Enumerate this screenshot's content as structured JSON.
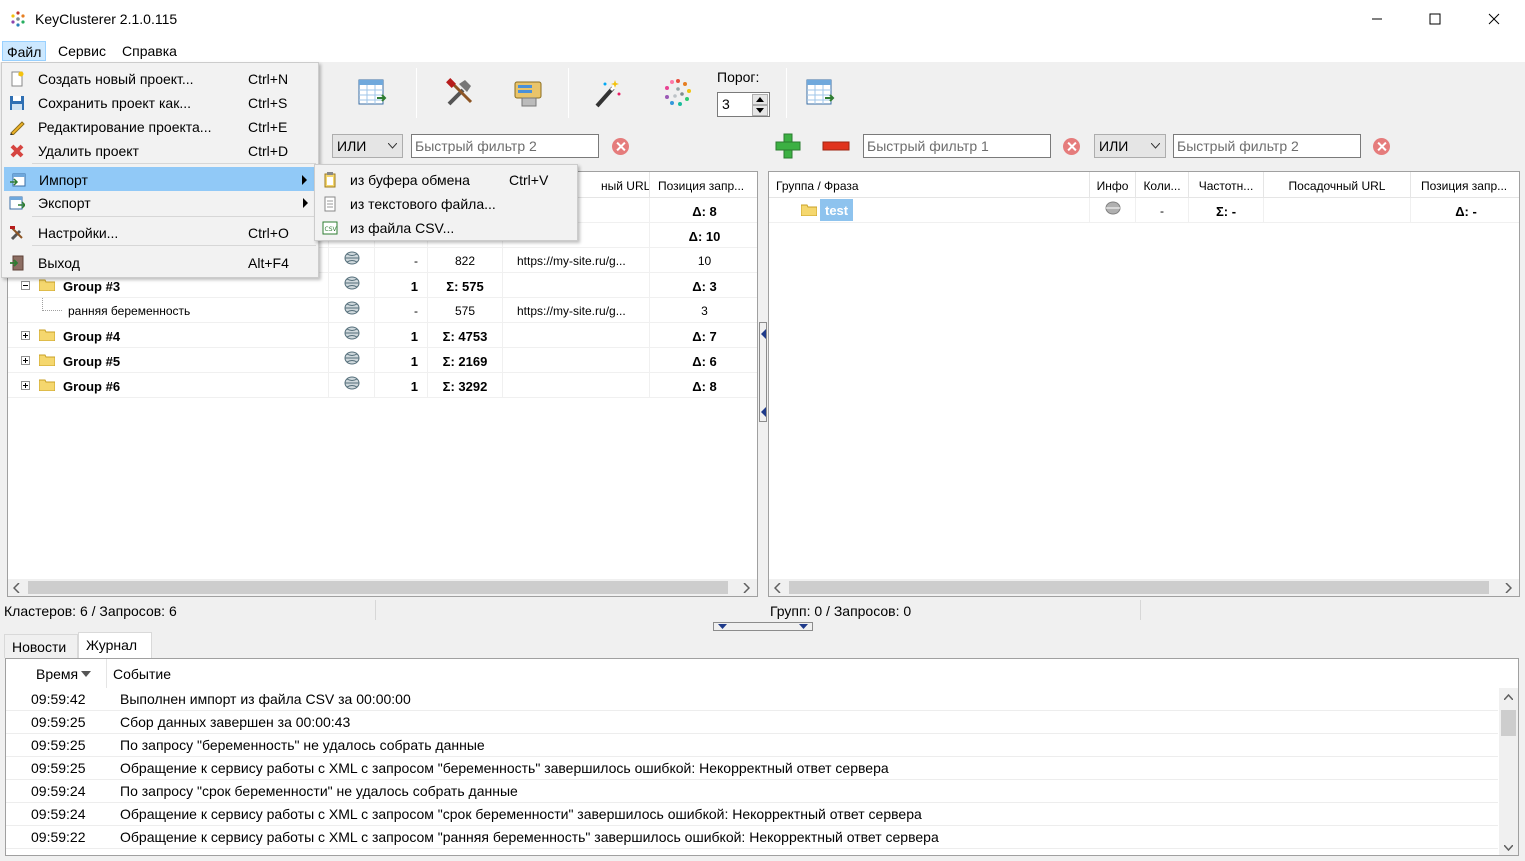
{
  "window": {
    "title": "KeyClusterer 2.1.0.115",
    "icon": "app-logo-icon"
  },
  "menubar": {
    "items": [
      "Файл",
      "Сервис",
      "Справка"
    ]
  },
  "toolbar": {
    "threshold_label": "Порог:",
    "threshold_value": "3"
  },
  "left_filters": {
    "operator": "ИЛИ",
    "filter2_placeholder": "Быстрый фильтр 2"
  },
  "right_filters": {
    "filter1_placeholder": "Быстрый фильтр 1",
    "operator": "ИЛИ",
    "filter2_placeholder": "Быстрый фильтр 2"
  },
  "left_grid": {
    "headers": {
      "url_partial": "ный URL",
      "position": "Позиция запр..."
    },
    "rows": [
      {
        "name": "",
        "count": "",
        "freq": "",
        "url": "",
        "pos": "Δ: 8",
        "bold": true
      },
      {
        "name": "",
        "count": "",
        "freq": "",
        "url": "",
        "pos": "Δ: 10",
        "bold": true
      },
      {
        "name": "",
        "count": "-",
        "freq": "822",
        "url": "https://my-site.ru/g...",
        "pos": "10",
        "bold": false
      },
      {
        "name": "Group #3",
        "count": "1",
        "freq": "Σ: 575",
        "url": "",
        "pos": "Δ: 3",
        "bold": true
      },
      {
        "name": "ранняя беременность",
        "count": "-",
        "freq": "575",
        "url": "https://my-site.ru/g...",
        "pos": "3",
        "bold": false
      },
      {
        "name": "Group #4",
        "count": "1",
        "freq": "Σ: 4753",
        "url": "",
        "pos": "Δ: 7",
        "bold": true
      },
      {
        "name": "Group #5",
        "count": "1",
        "freq": "Σ: 2169",
        "url": "",
        "pos": "Δ: 6",
        "bold": true
      },
      {
        "name": "Group #6",
        "count": "1",
        "freq": "Σ: 3292",
        "url": "",
        "pos": "Δ: 8",
        "bold": true
      }
    ]
  },
  "right_grid": {
    "headers": {
      "group": "Группа / Фраза",
      "info": "Инфо",
      "count": "Коли...",
      "freq": "Частотн...",
      "url": "Посадочный URL",
      "position": "Позиция запр..."
    },
    "rows": [
      {
        "name": "test",
        "count": "-",
        "freq": "Σ: -",
        "pos": "Δ: -"
      }
    ]
  },
  "status": {
    "left": "Кластеров: 6 / Запросов: 6",
    "right": "Групп: 0 / Запросов: 0"
  },
  "bottom_tabs": [
    "Новости",
    "Журнал"
  ],
  "log": {
    "col_time": "Время",
    "col_event": "Событие",
    "rows": [
      {
        "time": "09:59:42",
        "msg": "Выполнен импорт из файла CSV за 00:00:00"
      },
      {
        "time": "09:59:25",
        "msg": "Сбор данных завершен за 00:00:43"
      },
      {
        "time": "09:59:25",
        "msg": "По запросу \"беременность\" не удалось собрать данные"
      },
      {
        "time": "09:59:25",
        "msg": "Обращение к сервису работы с XML с запросом \"беременность\" завершилось ошибкой: Некорректный ответ сервера"
      },
      {
        "time": "09:59:24",
        "msg": "По запросу \"срок беременности\" не удалось собрать данные"
      },
      {
        "time": "09:59:24",
        "msg": "Обращение к сервису работы с XML с запросом \"срок беременности\" завершилось ошибкой: Некорректный ответ сервера"
      },
      {
        "time": "09:59:22",
        "msg": "Обращение к сервису работы с XML с запросом \"ранняя беременность\" завершилось ошибкой: Некорректный ответ сервера"
      }
    ]
  },
  "file_menu": {
    "items": [
      {
        "label": "Создать новый проект...",
        "shortcut": "Ctrl+N",
        "icon": "new-document-icon"
      },
      {
        "label": "Сохранить проект как...",
        "shortcut": "Ctrl+S",
        "icon": "floppy-disk-icon"
      },
      {
        "label": "Редактирование проекта...",
        "shortcut": "Ctrl+E",
        "icon": "pencil-icon"
      },
      {
        "label": "Удалить проект",
        "shortcut": "Ctrl+D",
        "icon": "red-cross-icon"
      },
      {
        "label": "Импорт",
        "shortcut": "",
        "icon": "import-icon"
      },
      {
        "label": "Экспорт",
        "shortcut": "",
        "icon": "export-icon"
      },
      {
        "label": "Настройки...",
        "shortcut": "Ctrl+O",
        "icon": "tools-icon"
      },
      {
        "label": "Выход",
        "shortcut": "Alt+F4",
        "icon": "exit-door-icon"
      }
    ]
  },
  "import_submenu": {
    "items": [
      {
        "label": "из буфера обмена",
        "shortcut": "Ctrl+V",
        "icon": "clipboard-icon"
      },
      {
        "label": "из текстового файла...",
        "shortcut": "",
        "icon": "text-file-icon"
      },
      {
        "label": "из файла CSV...",
        "shortcut": "",
        "icon": "csv-file-icon"
      }
    ]
  },
  "colors": {
    "menu_highlight": "#91c9f7",
    "selection": "#cce8ff",
    "add_green": "#3cb043",
    "remove_red": "#e0331c",
    "clear_red": "#e57c7c"
  }
}
